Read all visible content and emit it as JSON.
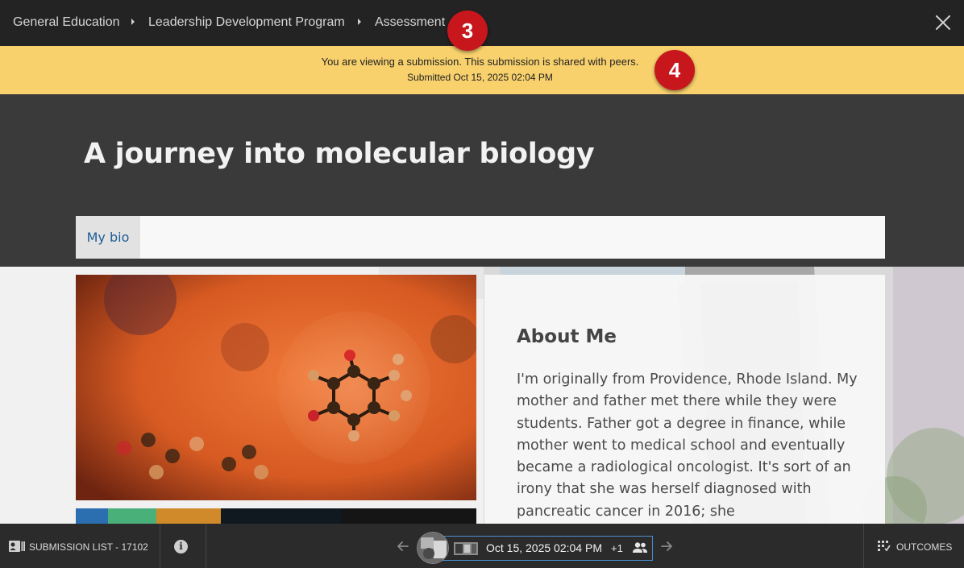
{
  "breadcrumbs": [
    "General Education",
    "Leadership Development Program",
    "Assessment"
  ],
  "markers": [
    "3",
    "4"
  ],
  "notice": {
    "message": "You are viewing a submission. This submission is shared with peers.",
    "submitted": "Submitted Oct 15, 2025 02:04 PM"
  },
  "page": {
    "title": "A journey into molecular biology",
    "tabs": [
      "My bio"
    ]
  },
  "about": {
    "heading": "About Me",
    "body": "I'm originally from Providence, Rhode Island. My mother and father met there while they were students. Father got a degree in finance, while mother went to medical school and eventually became a radiological oncologist. It's sort of an irony that she was herself diagnosed with pancreatic cancer in 2016; she"
  },
  "footer": {
    "submission_list": "SUBMISSION LIST - 17102",
    "submission_date": "Oct 15, 2025 02:04 PM",
    "extra_count": "+1",
    "outcomes": "OUTCOMES"
  },
  "icons": {
    "close": "close-icon",
    "submission_list": "id-card-icon",
    "info": "info-icon",
    "prev": "arrow-left-icon",
    "next": "arrow-right-icon",
    "peers": "people-icon",
    "outcomes": "outcomes-grid-icon"
  },
  "colors": {
    "topbar": "#232323",
    "notice": "#f8d16d",
    "hero": "#3a3a3a",
    "marker": "#c8161d",
    "link": "#1f5d96",
    "selector_border": "#4a8fd0"
  }
}
